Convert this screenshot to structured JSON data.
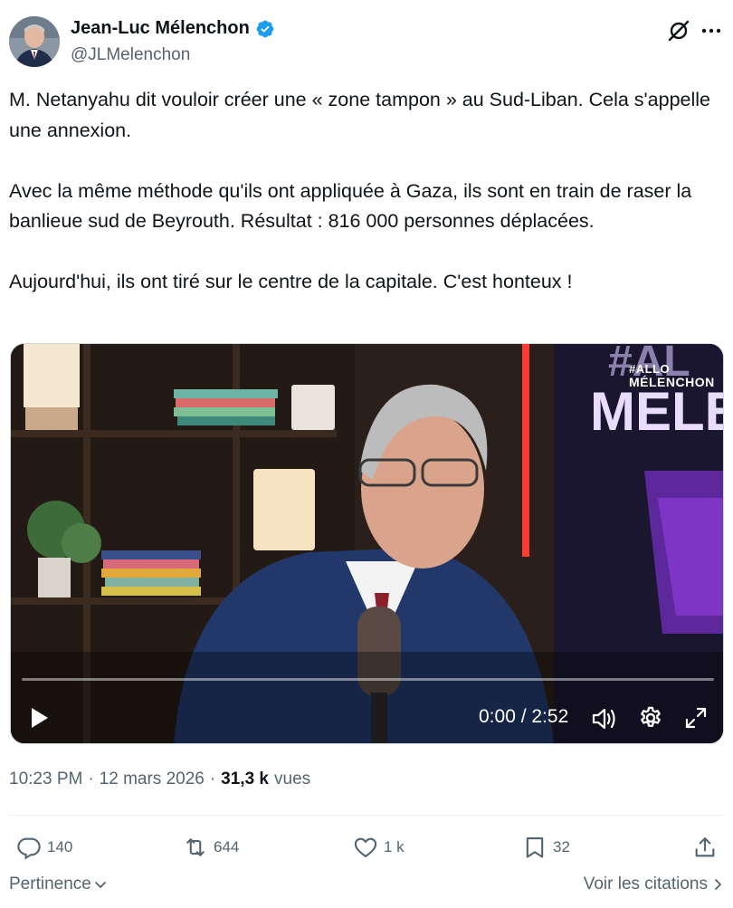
{
  "author": {
    "display_name": "Jean-Luc Mélenchon",
    "handle": "@JLMelenchon",
    "verified": true,
    "verified_color": "#1d9bf0"
  },
  "tweet": {
    "text": "M. Netanyahu dit vouloir créer une « zone tampon » au Sud-Liban. Cela s'appelle une annexion.\n\nAvec la même méthode qu'ils ont appliquée à Gaza, ils sont en train de raser la banlieue sud de Beyrouth. Résultat : 816 000 personnes déplacées.\n\nAujourd'hui, ils ont tiré sur le centre de la capitale. C'est honteux !"
  },
  "video": {
    "time_display": "0:00 / 2:52",
    "progress": 0,
    "watermark_line1": "#ALLO",
    "watermark_line2": "MÉLENCHON",
    "backdrop_text": "#AL MELEN"
  },
  "meta": {
    "time": "10:23 PM",
    "separator": "·",
    "date": "12 mars 2026",
    "views_count": "31,3 k",
    "views_label": "vues"
  },
  "actions": {
    "replies": "140",
    "reposts": "644",
    "likes": "1 k",
    "bookmarks": "32"
  },
  "footer": {
    "sort_label": "Pertinence",
    "quotes_label": "Voir les citations"
  },
  "icons": {
    "grok": "grok-icon",
    "more": "more-icon",
    "reply": "reply-icon",
    "repost": "repost-icon",
    "like": "heart-icon",
    "bookmark": "bookmark-icon",
    "share": "share-icon"
  },
  "colors": {
    "text_primary": "#0f1419",
    "text_secondary": "#536471",
    "divider": "#eff3f4"
  }
}
